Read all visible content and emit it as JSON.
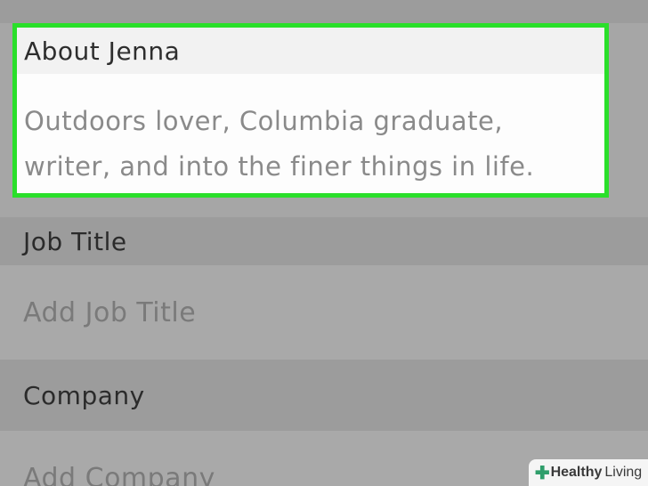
{
  "about": {
    "label": "About Jenna",
    "text": "Outdoors lover, Columbia graduate, writer, and into the finer things in life."
  },
  "job_title": {
    "label": "Job Title",
    "placeholder": "Add Job Title"
  },
  "company": {
    "label": "Company",
    "placeholder": "Add Company"
  },
  "watermark": {
    "brand_bold": "Healthy",
    "brand_light": "Living",
    "icon": "plus-icon"
  },
  "colors": {
    "highlight": "#2adf2a",
    "brand": "#2f9e6b"
  }
}
